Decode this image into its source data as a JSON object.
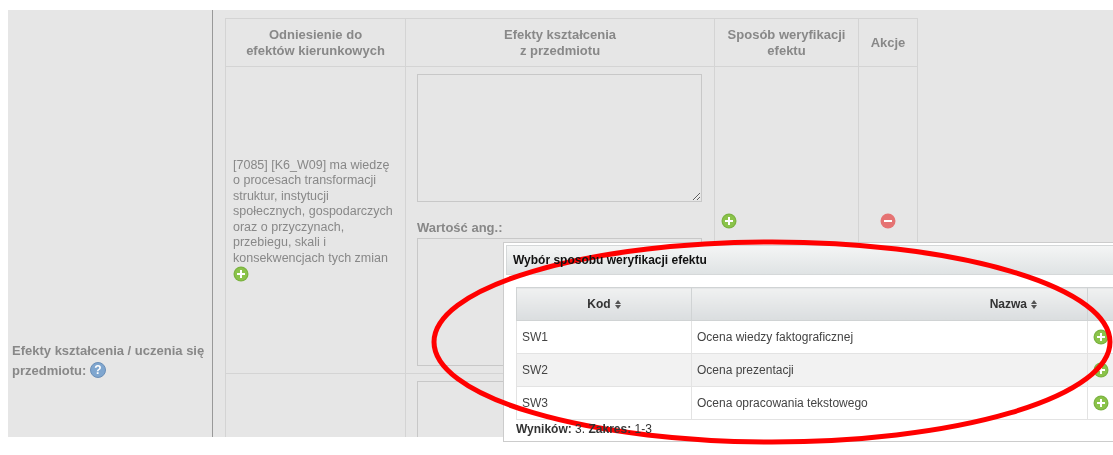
{
  "form": {
    "field_label": "Efekty kształcenia / uczenia się przedmiotu:",
    "help_glyph": "?"
  },
  "table": {
    "columns": [
      "Odniesienie do\nefektów kierunkowych",
      "Efekty kształcenia\nz przedmiotu",
      "Sposób weryfikacji\nefektu",
      "Akcje"
    ],
    "rows": [
      {
        "kind": "full",
        "reference": "[7085] [K6_W09] ma wiedzę o procesach transformacji struktur, instytucji społecznych, gospodarczych oraz o przyczynach, przebiegu, skali i konsekwencjach tych zmian",
        "translation_label": "Wartość ang.:"
      },
      {
        "kind": "cut"
      }
    ]
  },
  "dialog": {
    "title": "Wybór sposobu weryfikacji efektu",
    "columns": [
      {
        "label": "Kod",
        "sortable": true
      },
      {
        "label": "Nazwa",
        "sortable": true
      }
    ],
    "rows": [
      {
        "code": "SW1",
        "name": "Ocena wiedzy faktograficznej",
        "selected": false
      },
      {
        "code": "SW2",
        "name": "Ocena prezentacji",
        "selected": false
      },
      {
        "code": "SW3",
        "name": "Ocena opracowania tekstowego",
        "selected": false
      }
    ],
    "summary": "**Wyników:** 3. **Zakres:** 1-3"
  }
}
